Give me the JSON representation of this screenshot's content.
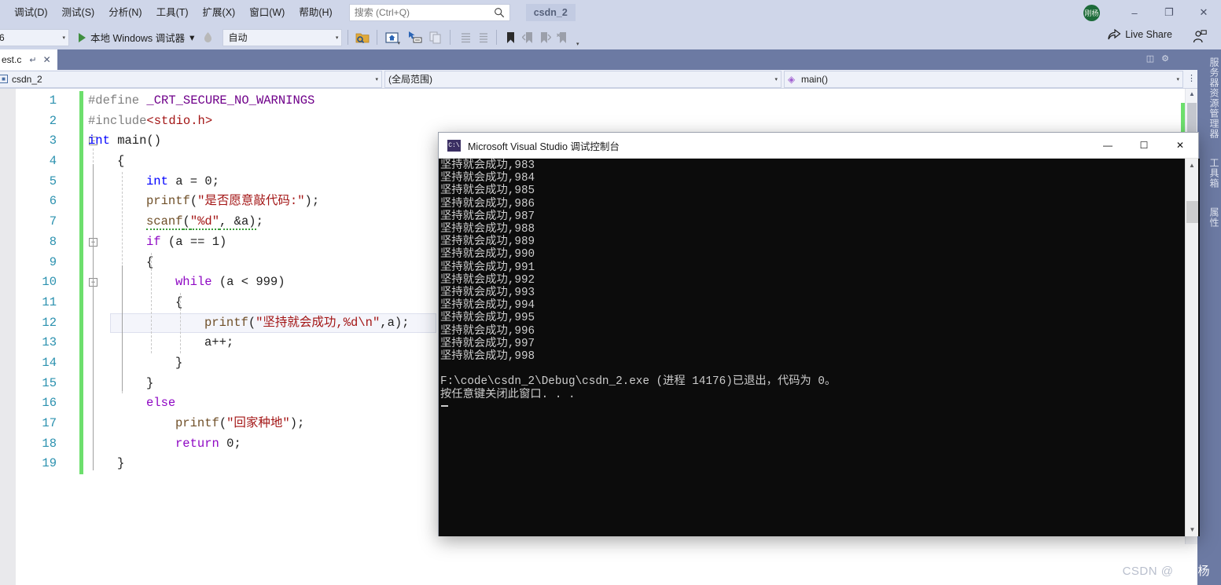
{
  "window": {
    "project_chip": "csdn_2",
    "minimize": "–",
    "maximize": "❐",
    "close": "✕",
    "avatar_text": "刚杨",
    "live_share": "Live Share"
  },
  "menu": {
    "items": [
      {
        "label": ")",
        "clipped": true
      },
      {
        "label": "调试(D)"
      },
      {
        "label": "测试(S)"
      },
      {
        "label": "分析(N)"
      },
      {
        "label": "工具(T)"
      },
      {
        "label": "扩展(X)"
      },
      {
        "label": "窗口(W)"
      },
      {
        "label": "帮助(H)"
      }
    ]
  },
  "search": {
    "placeholder": "搜索 (Ctrl+Q)",
    "value": ""
  },
  "toolbar": {
    "config_combo": "6",
    "run_label": "本地 Windows 调试器",
    "platform_combo": "自动",
    "caret": "▾",
    "overflow": "▾"
  },
  "document_tab": {
    "label": "est.c",
    "pin": "↵",
    "close": "✕"
  },
  "navbar": {
    "project": "csdn_2",
    "scope": "(全局范围)",
    "member": "main()",
    "caret": "▾"
  },
  "right_dock": {
    "items": [
      "服务器资源管理器",
      "工具箱",
      "属性"
    ]
  },
  "editor": {
    "current_line": 12,
    "lines": [
      {
        "n": 1,
        "indent": 0,
        "fold": null,
        "tokens": [
          {
            "t": "#define ",
            "c": "pp"
          },
          {
            "t": "_CRT_SECURE_NO_WARNINGS",
            "c": "macro"
          }
        ]
      },
      {
        "n": 2,
        "indent": 0,
        "fold": null,
        "tokens": [
          {
            "t": "#include",
            "c": "pp"
          },
          {
            "t": "<stdio.h>",
            "c": "inc"
          }
        ]
      },
      {
        "n": 3,
        "indent": 0,
        "fold": "minus",
        "tokens": [
          {
            "t": "int",
            "c": "kw"
          },
          {
            "t": " main()",
            "c": ""
          }
        ]
      },
      {
        "n": 4,
        "indent": 1,
        "fold": null,
        "tokens": [
          {
            "t": "{",
            "c": ""
          }
        ]
      },
      {
        "n": 5,
        "indent": 2,
        "fold": null,
        "tokens": [
          {
            "t": "int",
            "c": "kw"
          },
          {
            "t": " a = ",
            "c": ""
          },
          {
            "t": "0",
            "c": "num"
          },
          {
            "t": ";",
            "c": ""
          }
        ]
      },
      {
        "n": 6,
        "indent": 2,
        "fold": null,
        "tokens": [
          {
            "t": "printf",
            "c": "fn"
          },
          {
            "t": "(",
            "c": ""
          },
          {
            "t": "\"是否愿意敲代码:\"",
            "c": "str"
          },
          {
            "t": ");",
            "c": ""
          }
        ]
      },
      {
        "n": 7,
        "indent": 2,
        "fold": null,
        "tokens": [
          {
            "t": "scanf",
            "c": "fn squig"
          },
          {
            "t": "(",
            "c": "squig"
          },
          {
            "t": "\"%d\"",
            "c": "str squig"
          },
          {
            "t": ", &a)",
            "c": "squig"
          },
          {
            "t": ";",
            "c": ""
          }
        ]
      },
      {
        "n": 8,
        "indent": 2,
        "fold": "minus",
        "tokens": [
          {
            "t": "if",
            "c": "kwp"
          },
          {
            "t": " (a == ",
            "c": ""
          },
          {
            "t": "1",
            "c": "num"
          },
          {
            "t": ")",
            "c": ""
          }
        ]
      },
      {
        "n": 9,
        "indent": 2,
        "fold": null,
        "tokens": [
          {
            "t": "{",
            "c": ""
          }
        ]
      },
      {
        "n": 10,
        "indent": 3,
        "fold": "minus",
        "tokens": [
          {
            "t": "while",
            "c": "kwp"
          },
          {
            "t": " (a < ",
            "c": ""
          },
          {
            "t": "999",
            "c": "num"
          },
          {
            "t": ")",
            "c": ""
          }
        ]
      },
      {
        "n": 11,
        "indent": 3,
        "fold": null,
        "tokens": [
          {
            "t": "{",
            "c": ""
          }
        ]
      },
      {
        "n": 12,
        "indent": 4,
        "fold": null,
        "tokens": [
          {
            "t": "printf",
            "c": "fn"
          },
          {
            "t": "(",
            "c": ""
          },
          {
            "t": "\"坚持就会成功,%d",
            "c": "str"
          },
          {
            "t": "\\n",
            "c": "esc"
          },
          {
            "t": "\"",
            "c": "str"
          },
          {
            "t": ",a);",
            "c": ""
          }
        ]
      },
      {
        "n": 13,
        "indent": 4,
        "fold": null,
        "tokens": [
          {
            "t": "a++;",
            "c": ""
          }
        ]
      },
      {
        "n": 14,
        "indent": 3,
        "fold": null,
        "tokens": [
          {
            "t": "}",
            "c": ""
          }
        ]
      },
      {
        "n": 15,
        "indent": 2,
        "fold": null,
        "tokens": [
          {
            "t": "}",
            "c": ""
          }
        ]
      },
      {
        "n": 16,
        "indent": 2,
        "fold": null,
        "tokens": [
          {
            "t": "else",
            "c": "kwp"
          }
        ]
      },
      {
        "n": 17,
        "indent": 3,
        "fold": null,
        "tokens": [
          {
            "t": "printf",
            "c": "fn"
          },
          {
            "t": "(",
            "c": ""
          },
          {
            "t": "\"回家种地\"",
            "c": "str"
          },
          {
            "t": ");",
            "c": ""
          }
        ]
      },
      {
        "n": 18,
        "indent": 3,
        "fold": null,
        "tokens": [
          {
            "t": "return",
            "c": "kwp"
          },
          {
            "t": " ",
            "c": ""
          },
          {
            "t": "0",
            "c": "num"
          },
          {
            "t": ";",
            "c": ""
          }
        ]
      },
      {
        "n": 19,
        "indent": 1,
        "fold": null,
        "tokens": [
          {
            "t": "}",
            "c": ""
          }
        ]
      }
    ]
  },
  "console": {
    "title": "Microsoft Visual Studio 调试控制台",
    "icon_label": "C:\\",
    "minimize": "—",
    "maximize": "☐",
    "close": "✕",
    "scroll_up": "▲",
    "scroll_down": "▼",
    "output": "坚持就会成功,983\n坚持就会成功,984\n坚持就会成功,985\n坚持就会成功,986\n坚持就会成功,987\n坚持就会成功,988\n坚持就会成功,989\n坚持就会成功,990\n坚持就会成功,991\n坚持就会成功,992\n坚持就会成功,993\n坚持就会成功,994\n坚持就会成功,995\n坚持就会成功,996\n坚持就会成功,997\n坚持就会成功,998\n\nF:\\code\\csdn_2\\Debug\\csdn_2.exe (进程 14176)已退出，代码为 0。\n按任意键关闭此窗口. . ."
  },
  "watermark": {
    "prefix": "CSDN @",
    "author": "刚刚杨"
  }
}
